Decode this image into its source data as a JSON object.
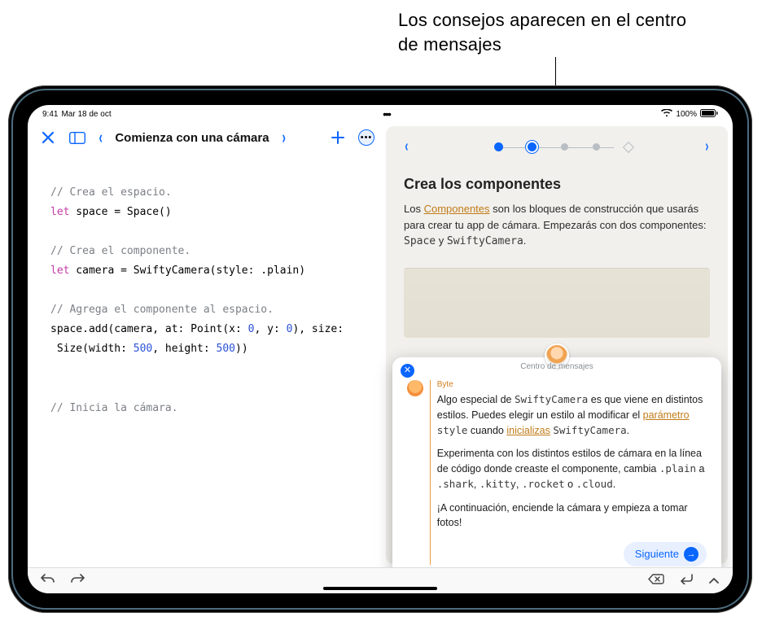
{
  "callout": "Los consejos aparecen en el centro de mensajes",
  "status": {
    "time": "9:41",
    "date": "Mar 18 de oct",
    "battery": "100%"
  },
  "toolbar": {
    "back_chevron": "‹",
    "title": "Comienza con una cámara",
    "fwd_chevron": "›"
  },
  "code": {
    "c1": "// Crea el espacio.",
    "l1a": "let",
    "l1b": " space = Space()",
    "c2": "// Crea el componente.",
    "l2a": "let",
    "l2b": " camera = SwiftyCamera(style: .plain)",
    "c3": "// Agrega el componente al espacio.",
    "l3": "space.add(camera, at: Point(x: ",
    "l3n1": "0",
    "l3m": ", y: ",
    "l3n2": "0",
    "l3e": "), size:",
    "l4": " Size(width: ",
    "l4n1": "500",
    "l4m": ", height: ",
    "l4n2": "500",
    "l4e": "))",
    "c4": "// Inicia la cámara."
  },
  "guide": {
    "title": "Crea los componentes",
    "p_pre": "Los ",
    "link": "Componentes",
    "p_post": " son los bloques de construcción que usarás para crear tu app de cámara. Empezarás con dos componentes: ",
    "mono1": "Space",
    "p_and": " y ",
    "mono2": "SwiftyCamera",
    "p_end": "."
  },
  "msg": {
    "header": "Centro de mensajes",
    "byte": "Byte",
    "p1a": "Algo especial de ",
    "p1m1": "SwiftyCamera",
    "p1b": " es que viene en distintos estilos. Puedes elegir un estilo al modificar el ",
    "p1link1": "parámetro",
    "p1c": " ",
    "p1m2": "style",
    "p1d": " cuando ",
    "p1link2": "inicializas",
    "p1e": " ",
    "p1m3": "SwiftyCamera",
    "p1f": ".",
    "p2a": "Experimenta con los distintos estilos de cámara en la línea de código donde creaste el componente, cambia ",
    "p2m1": ".plain",
    "p2b": " a ",
    "p2m2": ".shark",
    "p2c": ", ",
    "p2m3": ".kitty",
    "p2d": ", ",
    "p2m4": ".rocket",
    "p2e": " o ",
    "p2m5": ".cloud",
    "p2f": ".",
    "p3": "¡A continuación, enciende la cámara y empieza a tomar fotos!",
    "next": "Siguiente"
  }
}
